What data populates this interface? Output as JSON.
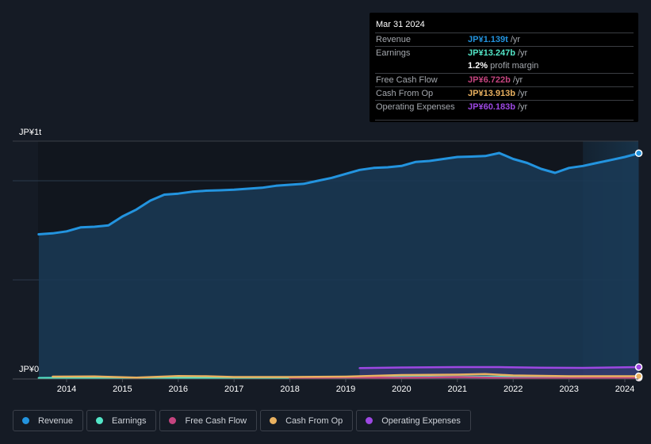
{
  "tooltip": {
    "date": "Mar 31 2024",
    "rows": [
      {
        "label": "Revenue",
        "value": "JP¥1.139t",
        "unit": " /yr",
        "color": "#2394df"
      },
      {
        "label": "Earnings",
        "value": "JP¥13.247b",
        "unit": " /yr",
        "color": "#53e6c8"
      },
      {
        "label": "",
        "value": "1.2%",
        "unit": " profit margin",
        "color": "#ffffff"
      },
      {
        "label": "Free Cash Flow",
        "value": "JP¥6.722b",
        "unit": " /yr",
        "color": "#c5447f"
      },
      {
        "label": "Cash From Op",
        "value": "JP¥13.913b",
        "unit": " /yr",
        "color": "#e9b160"
      },
      {
        "label": "Operating Expenses",
        "value": "JP¥60.183b",
        "unit": " /yr",
        "color": "#9d48e3"
      }
    ]
  },
  "legend": [
    {
      "label": "Revenue",
      "color": "#2394df"
    },
    {
      "label": "Earnings",
      "color": "#53e6c8"
    },
    {
      "label": "Free Cash Flow",
      "color": "#c5447f"
    },
    {
      "label": "Cash From Op",
      "color": "#e9b160"
    },
    {
      "label": "Operating Expenses",
      "color": "#9d48e3"
    }
  ],
  "chart_data": {
    "type": "area",
    "title": "",
    "xlabel": "",
    "ylabel": "",
    "y_unit": "JP¥ trillions",
    "ytick_labels": [
      "JP¥0",
      "JP¥1t"
    ],
    "ylim": [
      0,
      1.2
    ],
    "xlim": [
      2013.5,
      2024.25
    ],
    "xtick_labels": [
      "2014",
      "2015",
      "2016",
      "2017",
      "2018",
      "2019",
      "2020",
      "2021",
      "2022",
      "2023",
      "2024"
    ],
    "xticks": [
      2014,
      2015,
      2016,
      2017,
      2018,
      2019,
      2020,
      2021,
      2022,
      2023,
      2024
    ],
    "forecast_shade_from": 2023.25,
    "grid": true,
    "legend_position": "bottom",
    "series": [
      {
        "name": "Revenue",
        "color": "#2394df",
        "x": [
          2013.5,
          2013.75,
          2014.0,
          2014.25,
          2014.5,
          2014.75,
          2015.0,
          2015.25,
          2015.5,
          2015.75,
          2016.0,
          2016.25,
          2016.5,
          2016.75,
          2017.0,
          2017.25,
          2017.5,
          2017.75,
          2018.0,
          2018.25,
          2018.5,
          2018.75,
          2019.0,
          2019.25,
          2019.5,
          2019.75,
          2020.0,
          2020.25,
          2020.5,
          2020.75,
          2021.0,
          2021.25,
          2021.5,
          2021.75,
          2022.0,
          2022.25,
          2022.5,
          2022.75,
          2023.0,
          2023.25,
          2023.5,
          2023.75,
          2024.0,
          2024.25
        ],
        "values": [
          0.73,
          0.735,
          0.745,
          0.765,
          0.768,
          0.775,
          0.82,
          0.855,
          0.9,
          0.93,
          0.935,
          0.945,
          0.95,
          0.952,
          0.955,
          0.96,
          0.965,
          0.975,
          0.98,
          0.985,
          1.0,
          1.015,
          1.035,
          1.055,
          1.065,
          1.068,
          1.075,
          1.095,
          1.1,
          1.11,
          1.12,
          1.122,
          1.125,
          1.14,
          1.11,
          1.09,
          1.06,
          1.04,
          1.065,
          1.075,
          1.09,
          1.105,
          1.12,
          1.139
        ]
      },
      {
        "name": "Earnings",
        "color": "#53e6c8",
        "x": [
          2013.5,
          2014.0,
          2015.0,
          2016.0,
          2017.0,
          2018.0,
          2019.0,
          2020.0,
          2021.0,
          2022.0,
          2023.0,
          2024.25
        ],
        "values": [
          0.005,
          0.006,
          0.005,
          0.006,
          0.006,
          0.007,
          0.008,
          0.01,
          0.012,
          0.011,
          0.012,
          0.013
        ]
      },
      {
        "name": "Free Cash Flow",
        "color": "#c5447f",
        "x": [
          2018.0,
          2019.0,
          2020.0,
          2021.0,
          2022.0,
          2023.0,
          2024.25
        ],
        "values": [
          0.005,
          0.008,
          0.006,
          0.01,
          0.005,
          0.004,
          0.007
        ]
      },
      {
        "name": "Cash From Op",
        "color": "#e9b160",
        "x": [
          2013.75,
          2014.5,
          2015.25,
          2016.0,
          2016.5,
          2017.0,
          2018.0,
          2019.0,
          2020.0,
          2021.0,
          2021.5,
          2022.0,
          2023.0,
          2024.25
        ],
        "values": [
          0.012,
          0.013,
          0.007,
          0.015,
          0.014,
          0.01,
          0.01,
          0.012,
          0.02,
          0.022,
          0.025,
          0.018,
          0.014,
          0.014
        ]
      },
      {
        "name": "Operating Expenses",
        "color": "#9d48e3",
        "x": [
          2019.25,
          2020.0,
          2021.0,
          2021.75,
          2022.5,
          2023.25,
          2024.25
        ],
        "values": [
          0.055,
          0.058,
          0.06,
          0.06,
          0.057,
          0.056,
          0.06
        ]
      }
    ]
  }
}
